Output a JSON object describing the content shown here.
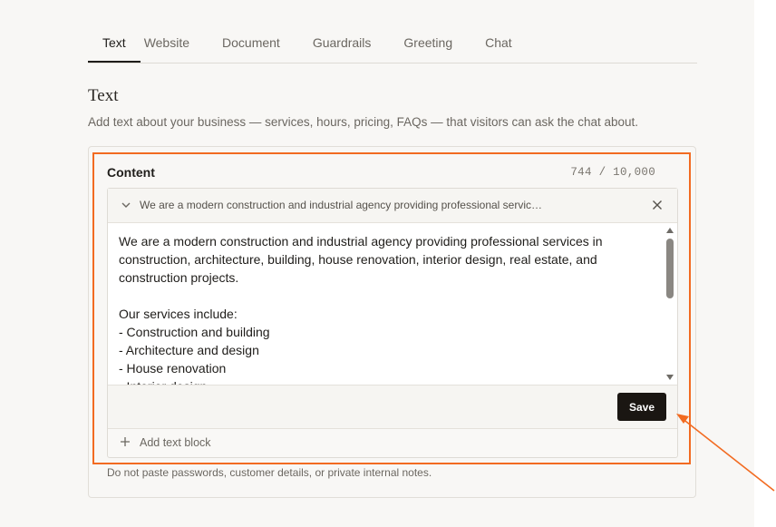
{
  "tabs": [
    {
      "label": "Text",
      "active": true
    },
    {
      "label": "Website",
      "active": false
    },
    {
      "label": "Document",
      "active": false
    },
    {
      "label": "Guardrails",
      "active": false
    },
    {
      "label": "Greeting",
      "active": false
    },
    {
      "label": "Chat",
      "active": false
    }
  ],
  "section": {
    "title": "Text",
    "description": "Add text about your business — services, hours, pricing, FAQs — that visitors can ask the chat about."
  },
  "content": {
    "label": "Content",
    "counter": "744 / 10,000",
    "block": {
      "title": "We are a modern construction and industrial agency providing professional servic…",
      "text": "We are a modern construction and industrial agency providing professional services in construction, architecture, building, house renovation, interior design, real estate, and construction projects.\n\nOur services include:\n- Construction and building\n- Architecture and design\n- House renovation\n- Interior design",
      "save_label": "Save"
    },
    "add_block_label": "Add text block"
  },
  "note": "Do not paste passwords, customer details, or private internal notes.",
  "colors": {
    "highlight": "#f26b21",
    "save_button": "#1a1612"
  },
  "icons": [
    "chevron-down-icon",
    "close-icon",
    "plus-icon",
    "scroll-up-icon",
    "scroll-down-icon"
  ]
}
